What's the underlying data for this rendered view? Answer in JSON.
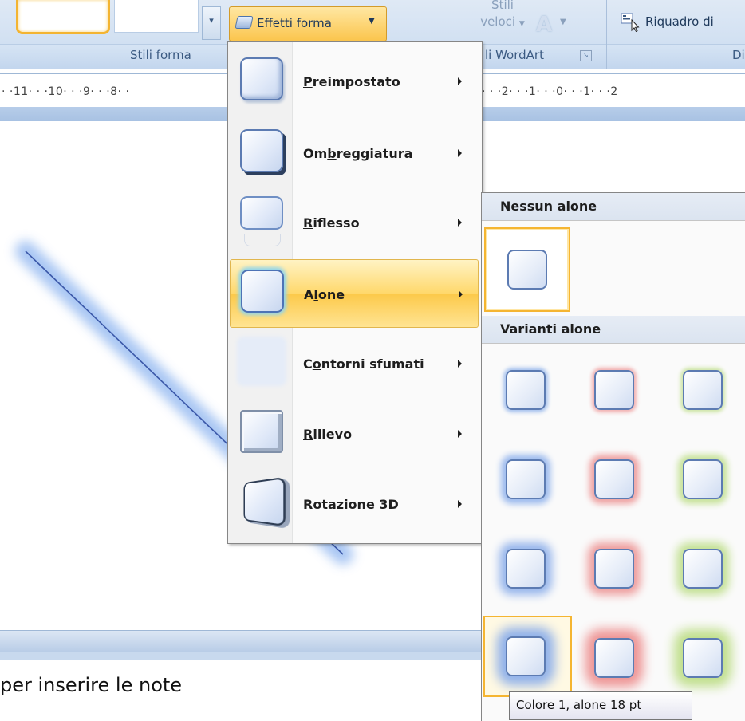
{
  "ribbon": {
    "shape_styles_label": "Stili forma",
    "shape_effects_label": "Effetti forma",
    "quick_styles_line1": "Stili",
    "quick_styles_line2": "veloci",
    "wordart_group_label": "li WordArt",
    "text_box_label": "Riquadro di",
    "arrange_group_label": "Di"
  },
  "ruler": {
    "left_ticks": "· ·11· · ·10· · ·9· · ·8· ·",
    "right_ticks": "· · ·2· · ·1· · ·0· · ·1· · ·2"
  },
  "notes": {
    "placeholder": "per inserire le note"
  },
  "effects_menu": {
    "items": [
      {
        "label": "Preimpostato",
        "mnemonic": "P"
      },
      {
        "label": "Ombreggiatura",
        "mnemonic": "b"
      },
      {
        "label": "Riflesso",
        "mnemonic": "R"
      },
      {
        "label": "Alone",
        "mnemonic": "l"
      },
      {
        "label": "Contorni sfumati",
        "mnemonic": "o"
      },
      {
        "label": "Rilievo",
        "mnemonic": "R"
      },
      {
        "label": "Rotazione 3D",
        "mnemonic": "D"
      }
    ],
    "highlighted": "Alone"
  },
  "glow_submenu": {
    "no_glow_header": "Nessun alone",
    "variants_header": "Varianti alone",
    "glow_colors": [
      "#7fa6e6",
      "#ef8f8f",
      "#b9dc7e"
    ],
    "selected_variant": "Colore 1, alone 18 pt"
  },
  "tooltip": {
    "text": "Colore 1, alone 18 pt"
  },
  "colors": {
    "ribbon_blue": "#c9dbf0",
    "highlight_orange": "#fcc94a",
    "line_blue": "#3a57a8",
    "glow_blue": "#9fc0f2"
  }
}
